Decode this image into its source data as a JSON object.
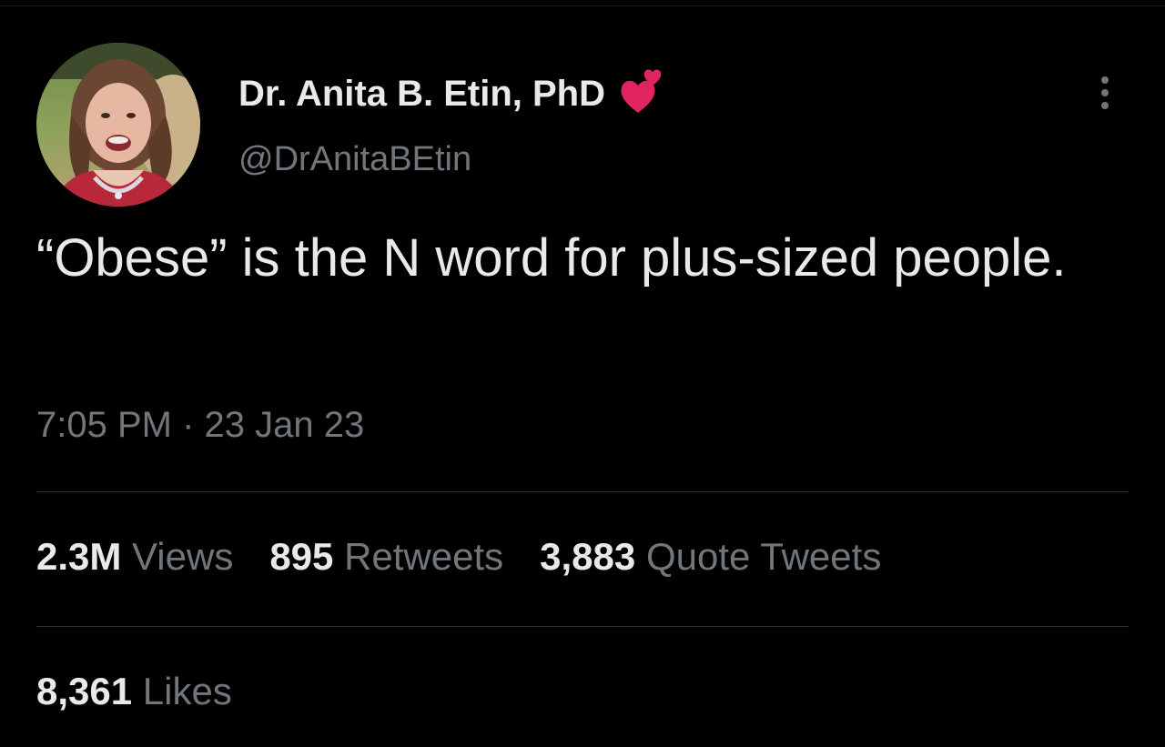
{
  "author": {
    "display_name": "Dr. Anita B. Etin, PhD",
    "handle": "@DrAnitaBEtin",
    "name_badge_icon": "two-hearts-icon",
    "avatar_icon": "profile-photo"
  },
  "tweet": {
    "text": "“Obese” is the N word for plus-sized people.",
    "timestamp": "7:05 PM · 23 Jan 23"
  },
  "stats": {
    "views": {
      "count": "2.3M",
      "label": "Views"
    },
    "retweets": {
      "count": "895",
      "label": "Retweets"
    },
    "quote_tweets": {
      "count": "3,883",
      "label": "Quote Tweets"
    },
    "likes": {
      "count": "8,361",
      "label": "Likes"
    }
  },
  "menu": {
    "more_icon": "more-vertical-icon"
  },
  "colors": {
    "background": "#000000",
    "primary_text": "#e7e9ea",
    "secondary_text": "#71767b",
    "divider": "#2f3336",
    "heart": "#e0245e"
  }
}
